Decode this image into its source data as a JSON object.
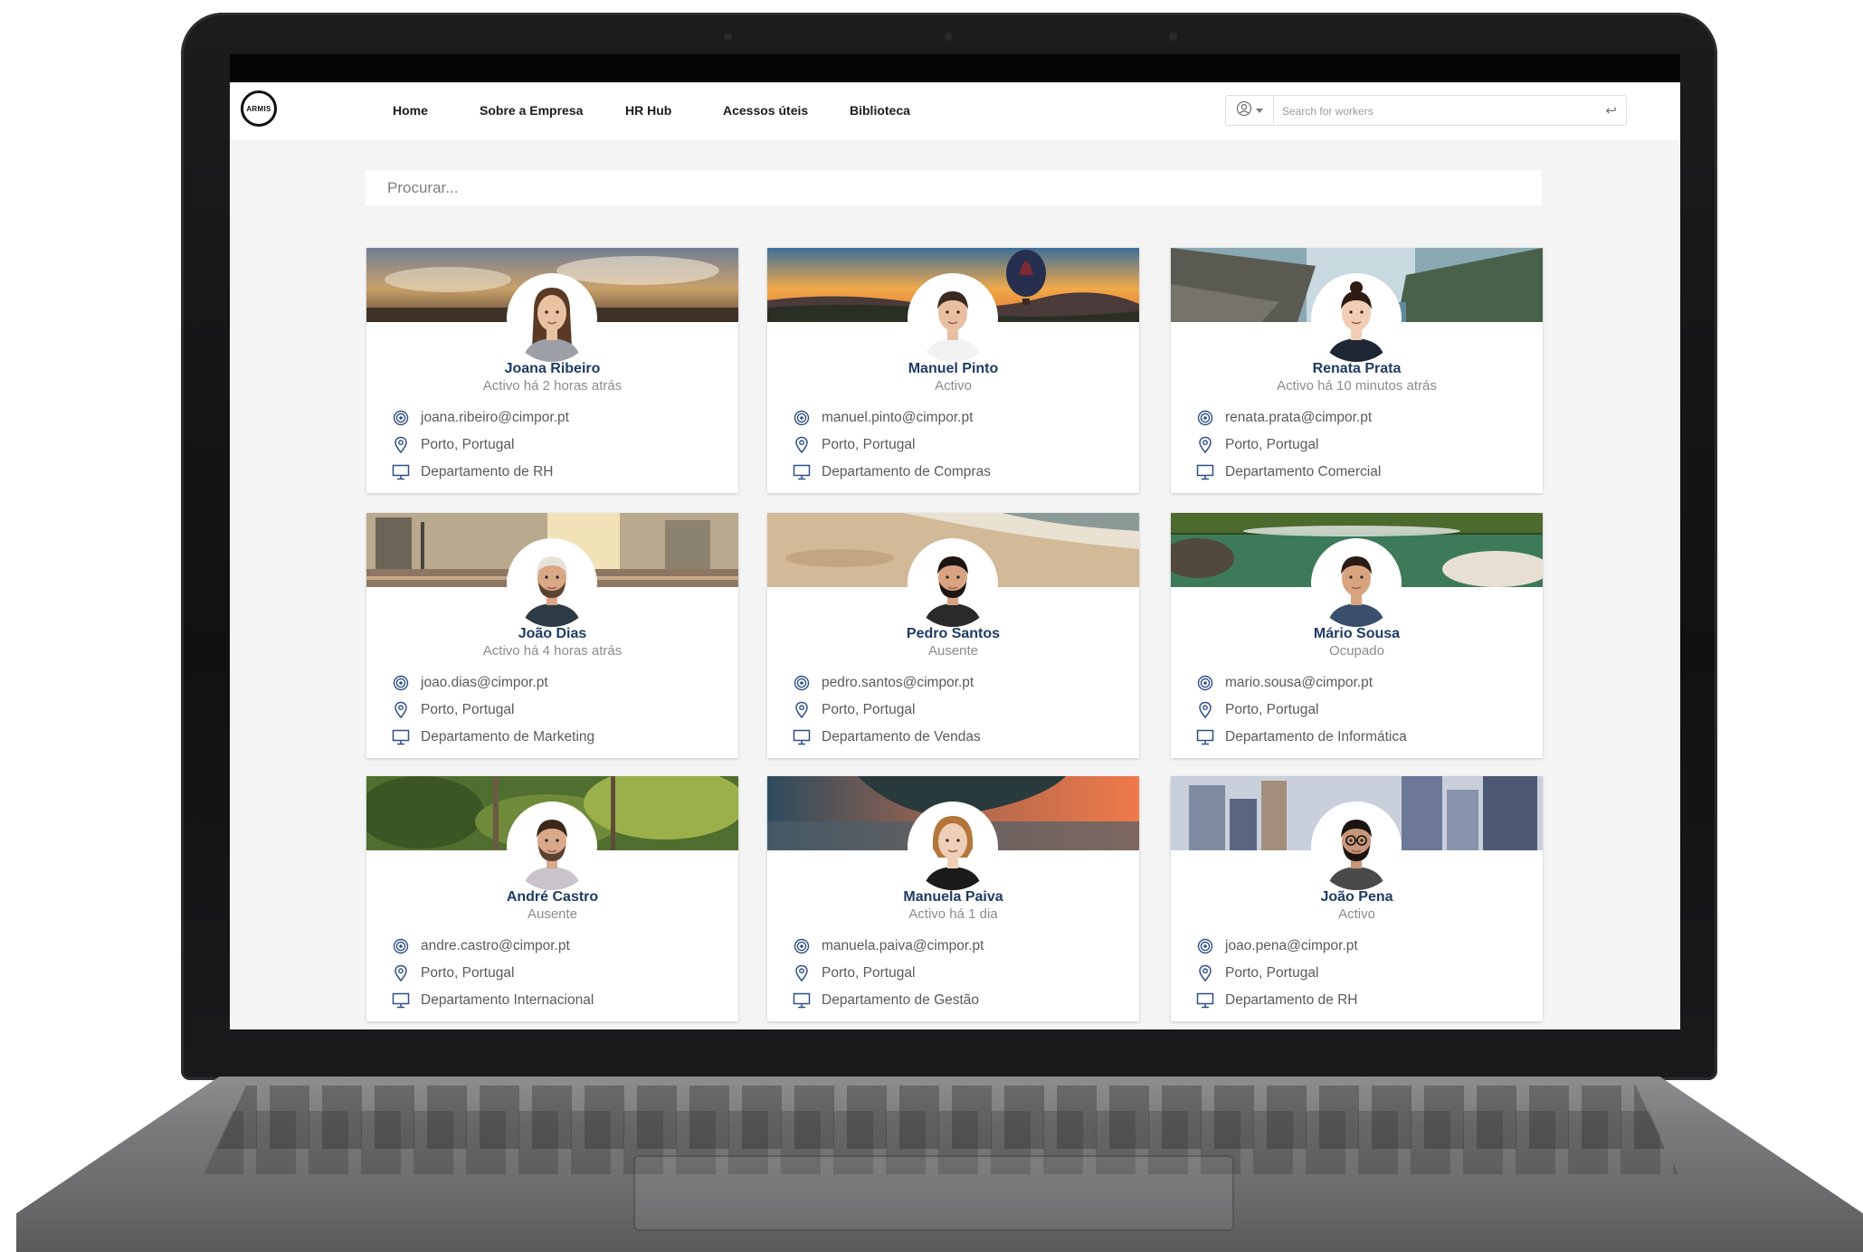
{
  "logo": {
    "text": "ARMIS"
  },
  "nav": {
    "items": [
      "Home",
      "Sobre a Empresa",
      "HR Hub",
      "Acessos úteis",
      "Biblioteca"
    ]
  },
  "worker_search": {
    "placeholder": "Search for workers"
  },
  "main_search": {
    "placeholder": "Procurar..."
  },
  "colors": {
    "name": "#1f3b63",
    "icon": "#2f4f86",
    "status": "#8b8b8b"
  },
  "icons": {
    "email": "at-sign-icon",
    "location": "map-pin-icon",
    "department": "monitor-icon",
    "submit": "enter-arrow-icon",
    "user": "user-circle-icon"
  },
  "workers": [
    {
      "name": "Joana Ribeiro",
      "status": "Activo há 2 horas atrás",
      "email": "joana.ribeiro@cimpor.pt",
      "location": "Porto, Portugal",
      "department": "Departamento de RH",
      "banner": "sunset-clouds",
      "avatar": "woman-long-hair"
    },
    {
      "name": "Manuel Pinto",
      "status": "Activo",
      "email": "manuel.pinto@cimpor.pt",
      "location": "Porto, Portugal",
      "department": "Departamento de Compras",
      "banner": "hot-air-balloon-sunset",
      "avatar": "man-short-hair"
    },
    {
      "name": "Renata Prata",
      "status": "Activo há 10 minutos atrás",
      "email": "renata.prata@cimpor.pt",
      "location": "Porto, Portugal",
      "department": "Departamento Comercial",
      "banner": "rocky-mountains",
      "avatar": "woman-bun"
    },
    {
      "name": "João Dias",
      "status": "Activo há 4 horas atrás",
      "email": "joao.dias@cimpor.pt",
      "location": "Porto, Portugal",
      "department": "Departamento de Marketing",
      "banner": "city-street",
      "avatar": "man-beard-cap"
    },
    {
      "name": "Pedro Santos",
      "status": "Ausente",
      "email": "pedro.santos@cimpor.pt",
      "location": "Porto, Portugal",
      "department": "Departamento de Vendas",
      "banner": "beach",
      "avatar": "man-full-beard"
    },
    {
      "name": "Mário Sousa",
      "status": "Ocupado",
      "email": "mario.sousa@cimpor.pt",
      "location": "Porto, Portugal",
      "department": "Departamento de Informática",
      "banner": "river-forest",
      "avatar": "man-smiling"
    },
    {
      "name": "André Castro",
      "status": "Ausente",
      "email": "andre.castro@cimpor.pt",
      "location": "Porto, Portugal",
      "department": "Departamento Internacional",
      "banner": "forest",
      "avatar": "man-stubble"
    },
    {
      "name": "Manuela Paiva",
      "status": "Activo há 1 dia",
      "email": "manuela.paiva@cimpor.pt",
      "location": "Porto, Portugal",
      "department": "Departamento de Gestão",
      "banner": "lake-sunset",
      "avatar": "woman-short-hair"
    },
    {
      "name": "João Pena",
      "status": "Activo",
      "email": "joao.pena@cimpor.pt",
      "location": "Porto, Portugal",
      "department": "Departamento de RH",
      "banner": "skyscrapers",
      "avatar": "man-glasses-beard"
    }
  ]
}
